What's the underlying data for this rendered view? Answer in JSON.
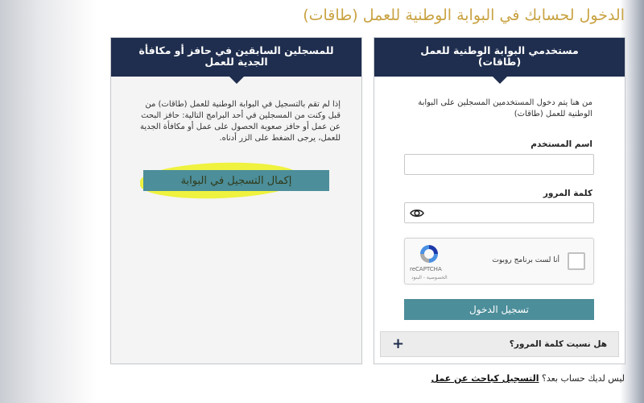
{
  "page": {
    "title": "الدخول لحسابك في البوابة الوطنية للعمل (طاقات)"
  },
  "left_panel": {
    "heading": "للمسجلين السابقين في حافز أو مكافأة الجدية للعمل",
    "description": "إذا لم تقم بالتسجيل في البوابة الوطنية للعمل (طاقات) من قبل وكنت من المسجلين في أحد البرامج التالية: حافز البحث عن عمل أو حافز صعوبة الحصول على عمل أو مكافأة الجدية للعمل، يرجى الضغط على الزر أدناه.",
    "button_label": "إكمال التسجيل في البوابة"
  },
  "right_panel": {
    "heading": "مستخدمي البوابة الوطنية للعمل (طاقات)",
    "description": "من هنا يتم دخول المستخدمين المسجلين على البوابة الوطنية للعمل (طاقات)",
    "username_label": "اسم المستخدم",
    "password_label": "كلمة المرور",
    "captcha_label": "أنا لست برنامج روبوت",
    "captcha_brand": "reCAPTCHA",
    "captcha_terms": "الخصوصية - البنود",
    "login_button": "تسجيل الدخول",
    "forgot_password": "هل نسيت كلمة المرور؟",
    "forgot_icon": "+"
  },
  "footer": {
    "question": "ليس لديك حساب بعد؟",
    "link": "التسجيل كباحث عن عمل"
  },
  "colors": {
    "title": "#c9a343",
    "header": "#1f2e4e",
    "button": "#4c8e9a",
    "highlight": "#eef22a"
  }
}
